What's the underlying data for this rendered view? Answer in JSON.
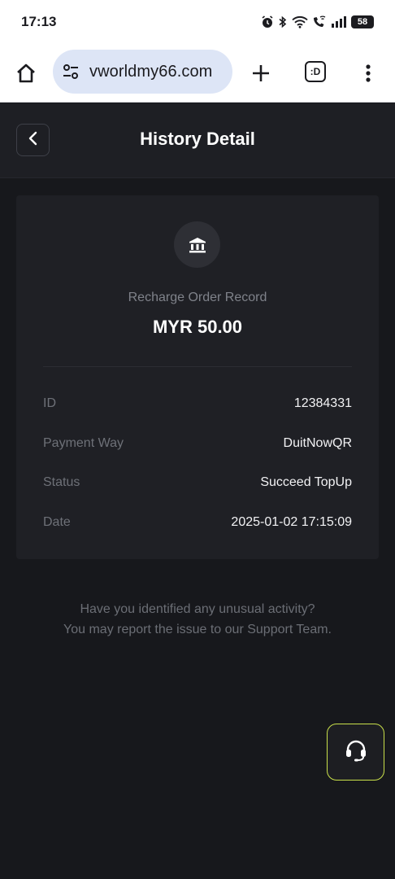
{
  "status_bar": {
    "time": "17:13",
    "battery": "58",
    "icons": [
      "alarm-icon",
      "bluetooth-icon",
      "wifi-icon",
      "wifi-calling-icon",
      "signal-icon",
      "battery-icon"
    ]
  },
  "browser": {
    "url": "vworldmy66.com",
    "tabs_label": ":D",
    "icons": [
      "home-icon",
      "tune-icon",
      "plus-icon",
      "more-vert-icon"
    ],
    "url_pill_color": "#dde5f6"
  },
  "header": {
    "title": "History Detail",
    "back_icon": "chevron-left-icon"
  },
  "card": {
    "icon": "bank-icon",
    "record_title": "Recharge Order Record",
    "amount": "MYR 50.00",
    "rows": [
      {
        "label": "ID",
        "value": "12384331"
      },
      {
        "label": "Payment Way",
        "value": "DuitNowQR"
      },
      {
        "label": "Status",
        "value": "Succeed TopUp"
      },
      {
        "label": "Date",
        "value": "2025-01-02 17:15:09"
      }
    ]
  },
  "notice": {
    "line1": "Have you identified any unusual activity?",
    "line2": "You may report the issue to our Support Team."
  },
  "support": {
    "icon": "headset-icon",
    "accent": "#c9e04a"
  },
  "colors": {
    "page_bg": "#17181c",
    "card_bg": "#1f2025",
    "label": "#6e7178",
    "value": "#f2f2f4"
  }
}
